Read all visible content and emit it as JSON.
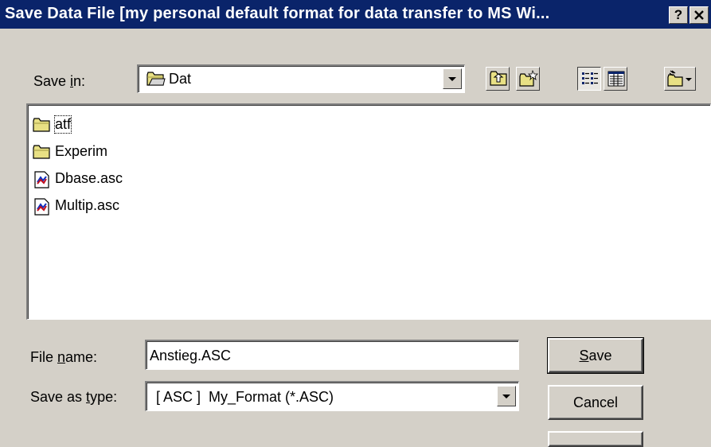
{
  "dialog": {
    "title": "Save Data File [my personal default format for data transfer to MS Wi...",
    "help_label": "?",
    "close_label": "✕"
  },
  "save_in": {
    "label_pre": "Save ",
    "label_accel": "i",
    "label_post": "n:",
    "value": "Dat",
    "value_icon": "folder-icon"
  },
  "toolbar": {
    "buttons": [
      {
        "name": "up-one-level-button",
        "icon": "folder-up-icon"
      },
      {
        "name": "create-new-folder-button",
        "icon": "new-folder-icon"
      },
      {
        "name": "list-view-button",
        "icon": "list-view-icon",
        "pressed": true
      },
      {
        "name": "details-view-button",
        "icon": "details-view-icon"
      },
      {
        "name": "view-menu-button",
        "icon": "view-menu-icon"
      }
    ]
  },
  "files": [
    {
      "name": "atf",
      "icon": "folder-icon",
      "focused": true
    },
    {
      "name": "Experim",
      "icon": "folder-icon"
    },
    {
      "name": "Dbase.asc",
      "icon": "data-file-icon"
    },
    {
      "name": "Multip.asc",
      "icon": "data-file-icon"
    }
  ],
  "file_name": {
    "label_pre": "File ",
    "label_accel": "n",
    "label_post": "ame:",
    "value": "Anstieg.ASC"
  },
  "save_as_type": {
    "label_pre": "Save as ",
    "label_accel": "t",
    "label_post": "ype:",
    "value": "[ ASC ]  My_Format (*.ASC)"
  },
  "buttons": {
    "save_accel": "S",
    "save_rest": "ave",
    "cancel": "Cancel"
  }
}
